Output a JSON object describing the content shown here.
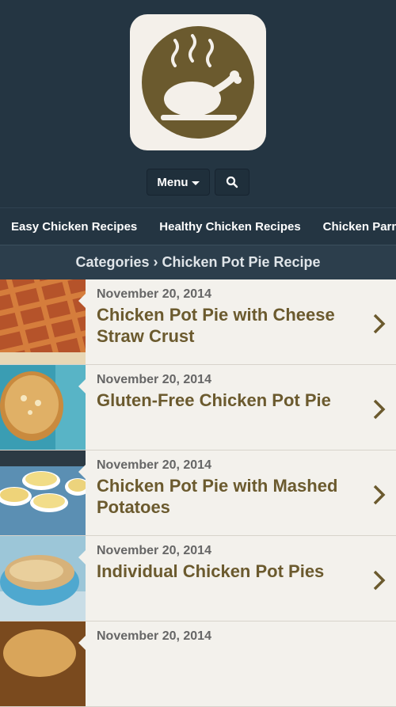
{
  "header": {
    "menu_label": "Menu"
  },
  "categories": [
    "Easy Chicken Recipes",
    "Healthy Chicken Recipes",
    "Chicken Parmesan"
  ],
  "breadcrumb": "Categories › Chicken Pot Pie Recipe",
  "colors": {
    "header_bg": "#243542",
    "logo_brown": "#6b5a2e",
    "list_bg": "#f3f1ec",
    "title_brown": "#6b5a2e"
  },
  "posts": [
    {
      "date": "November 20, 2014",
      "title": "Chicken Pot Pie with Cheese Straw Crust"
    },
    {
      "date": "November 20, 2014",
      "title": "Gluten-Free Chicken Pot Pie"
    },
    {
      "date": "November 20, 2014",
      "title": "Chicken Pot Pie with Mashed Potatoes"
    },
    {
      "date": "November 20, 2014",
      "title": "Individual Chicken Pot Pies"
    },
    {
      "date": "November 20, 2014",
      "title": ""
    }
  ]
}
